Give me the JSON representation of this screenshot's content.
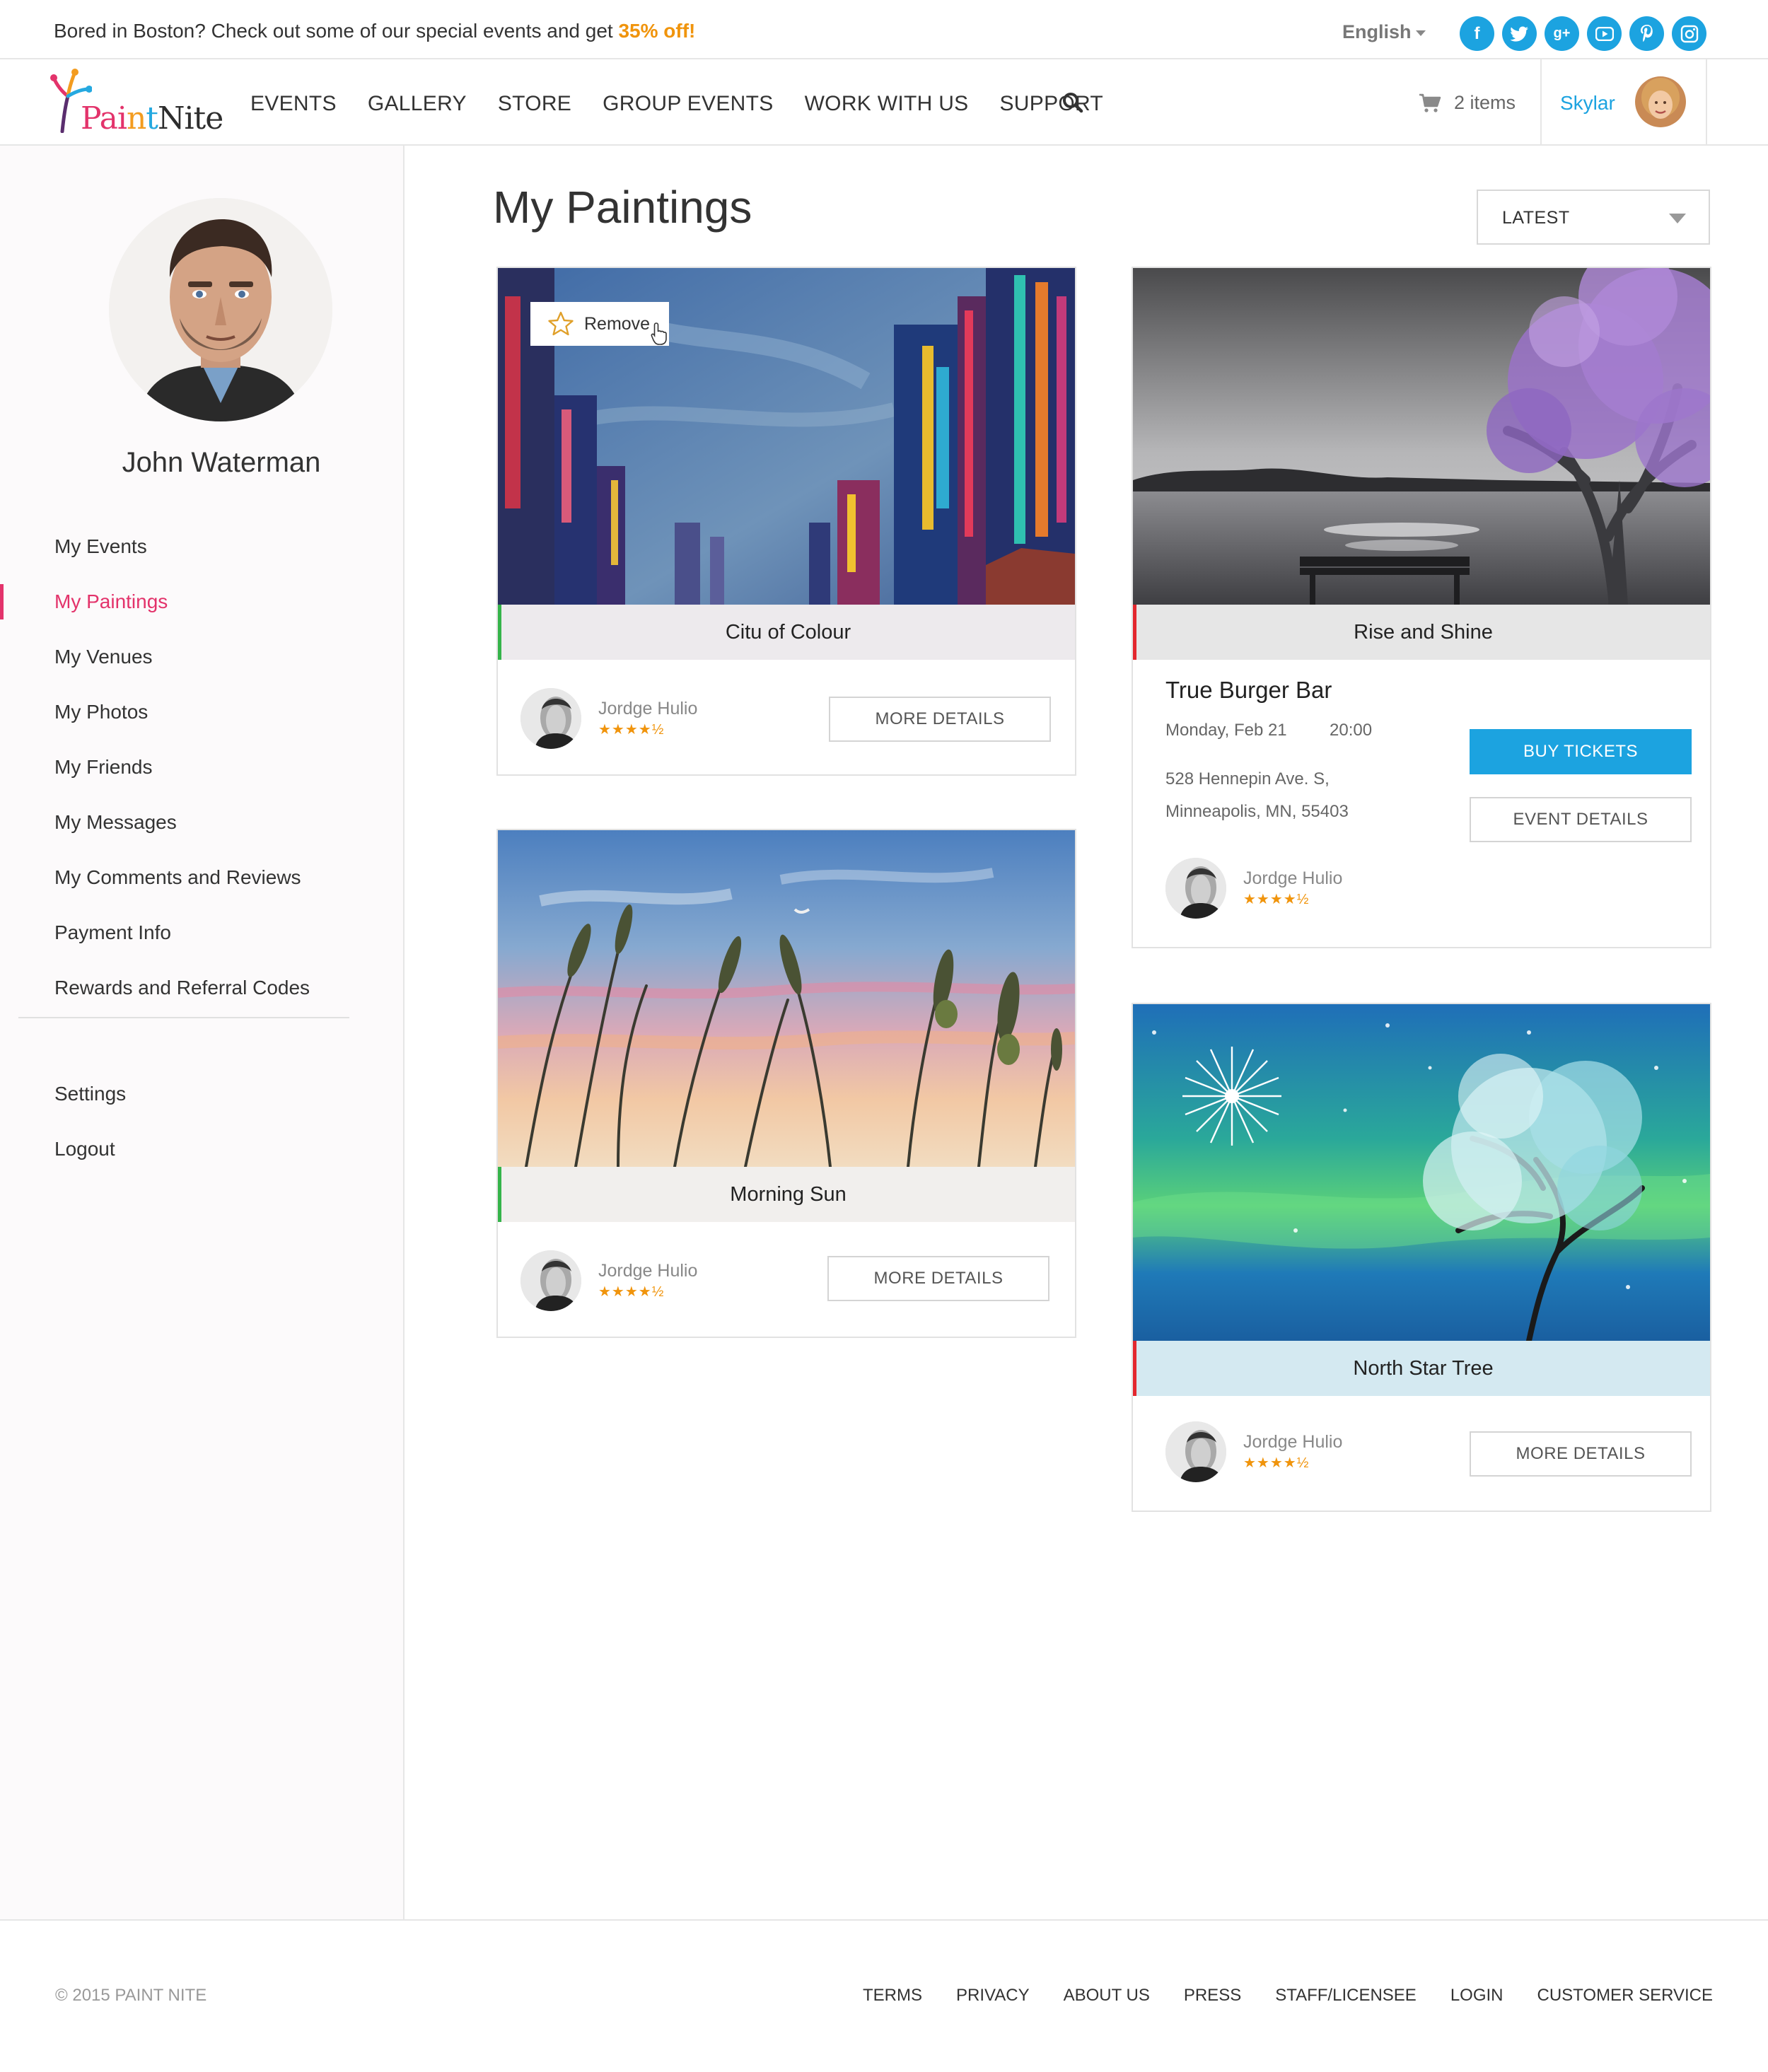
{
  "promo": {
    "text": "Bored in Boston? Check out some of our special events and get ",
    "highlight": "35% off!",
    "language": "English",
    "socials": [
      {
        "name": "facebook-icon",
        "glyph": "f"
      },
      {
        "name": "twitter-icon",
        "glyph": "t"
      },
      {
        "name": "google-plus-icon",
        "glyph": "g+"
      },
      {
        "name": "youtube-icon",
        "glyph": "▶"
      },
      {
        "name": "pinterest-icon",
        "glyph": "p"
      },
      {
        "name": "instagram-icon",
        "glyph": "◎"
      }
    ]
  },
  "nav": {
    "logo_text": [
      "Pai",
      "n",
      "t",
      "Nite"
    ],
    "items": [
      "EVENTS",
      "GALLERY",
      "STORE",
      "GROUP EVENTS",
      "WORK WITH US",
      "SUPPORT"
    ],
    "cart": "2 items",
    "user": "Skylar"
  },
  "sidebar": {
    "name": "John Waterman",
    "menu": [
      "My Events",
      "My Paintings",
      "My Venues",
      "My Photos",
      "My Friends",
      "My Messages",
      "My Comments and Reviews",
      "Payment Info",
      "Rewards and Referral Codes"
    ],
    "active_index": 1,
    "menu2": [
      "Settings",
      "Logout"
    ]
  },
  "main": {
    "title": "My Paintings",
    "sort": "LATEST",
    "remove_label": "Remove",
    "cards": [
      {
        "caption": "Citu of Colour",
        "artist": "Jordge Hulio",
        "rating": "★★★★½",
        "button": "MORE DETAILS"
      },
      {
        "caption": "Rise and Shine",
        "artist": "Jordge Hulio",
        "rating": "★★★★½",
        "venue": "True Burger Bar",
        "date": "Monday, Feb 21",
        "time": "20:00",
        "address1": "528 Hennepin Ave. S,",
        "address2": "Minneapolis, MN, 55403",
        "buy": "BUY TICKETS",
        "details": "EVENT DETAILS"
      },
      {
        "caption": "Morning Sun",
        "artist": "Jordge Hulio",
        "rating": "★★★★½",
        "button": "MORE DETAILS"
      },
      {
        "caption": "North Star Tree",
        "artist": "Jordge Hulio",
        "rating": "★★★★½",
        "button": "MORE DETAILS"
      }
    ]
  },
  "footer": {
    "copyright": "© 2015 PAINT NITE",
    "links": [
      "TERMS",
      "PRIVACY",
      "ABOUT US",
      "PRESS",
      "STAFF/LICENSEE",
      "LOGIN",
      "CUSTOMER SERVICE"
    ]
  },
  "colors": {
    "accent_pink": "#e3336b",
    "accent_blue": "#1ca3e0",
    "accent_orange": "#f0940c",
    "caption_green": "#35b44a",
    "caption_red": "#e3272e"
  }
}
